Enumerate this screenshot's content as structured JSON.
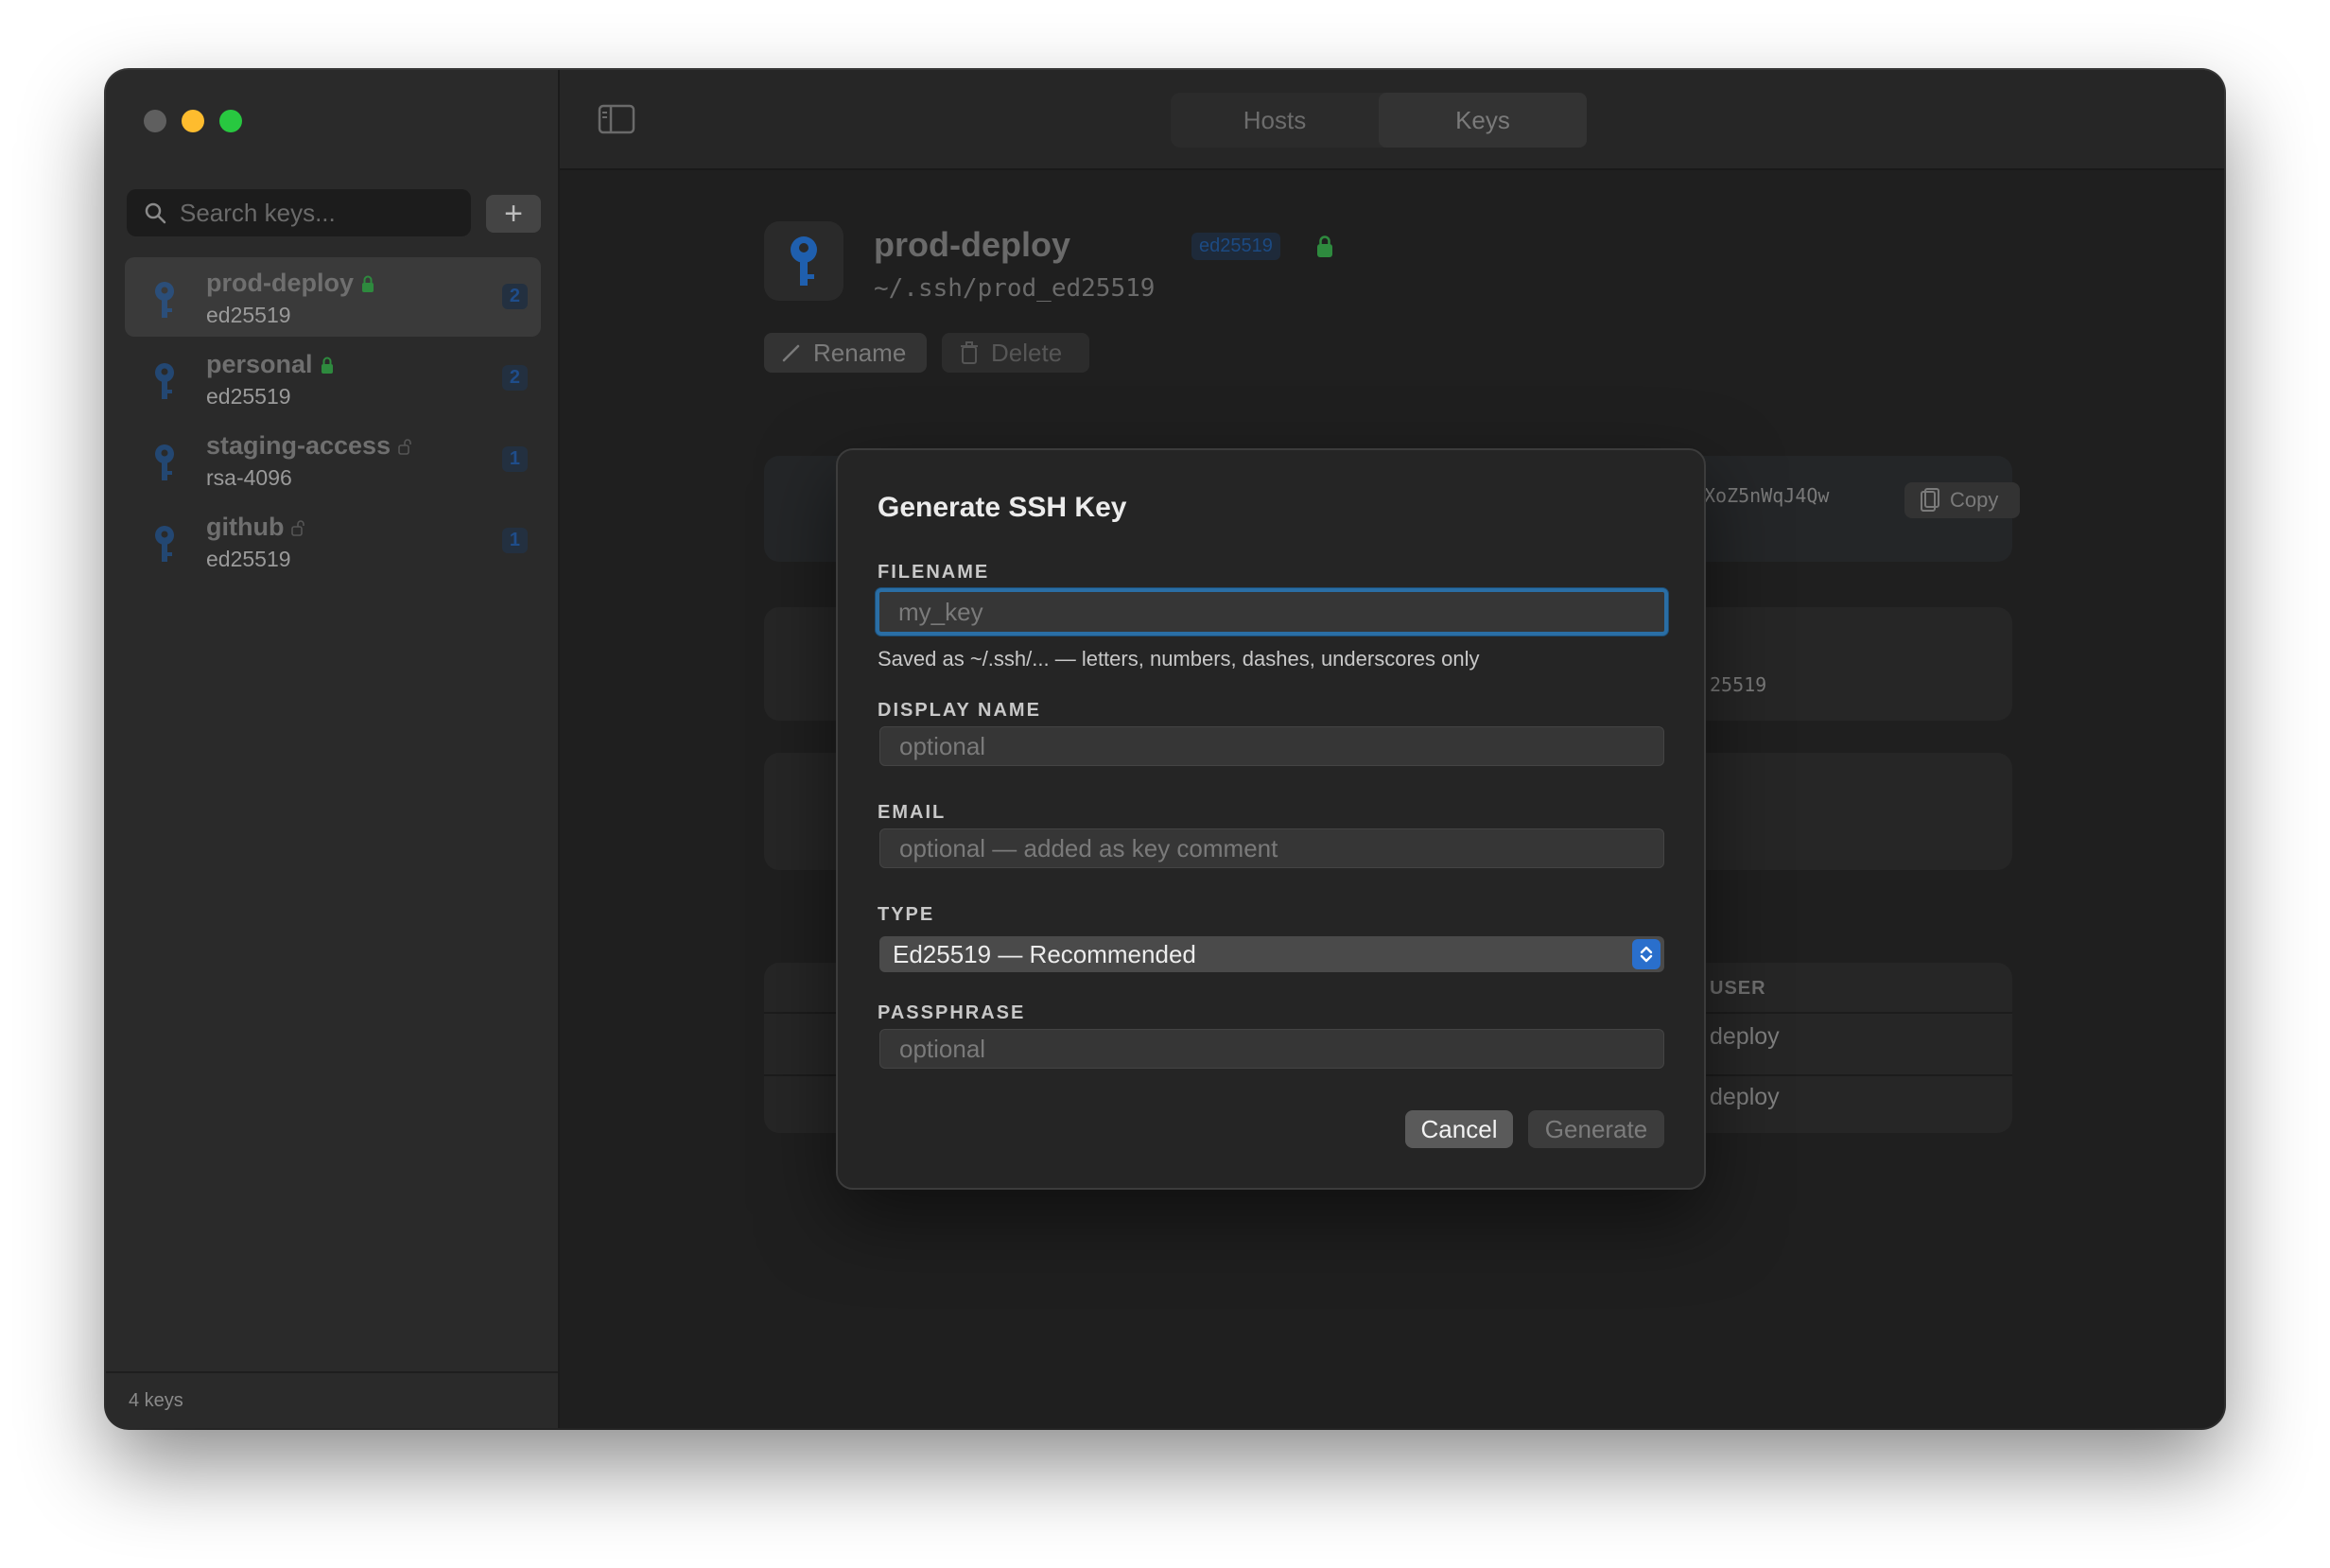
{
  "window": {
    "tabs": [
      {
        "label": "Hosts",
        "active": false
      },
      {
        "label": "Keys",
        "active": true
      }
    ]
  },
  "sidebar": {
    "search_placeholder": "Search keys...",
    "add_label": "+",
    "items": [
      {
        "name": "prod-deploy",
        "type": "ed25519",
        "count": "2",
        "locked": true,
        "selected": true
      },
      {
        "name": "personal",
        "type": "ed25519",
        "count": "2",
        "locked": true,
        "selected": false
      },
      {
        "name": "staging-access",
        "type": "rsa-4096",
        "count": "1",
        "locked": false,
        "selected": false
      },
      {
        "name": "github",
        "type": "ed25519",
        "count": "1",
        "locked": false,
        "selected": false
      }
    ],
    "footer": "4 keys"
  },
  "detail": {
    "title": "prod-deploy",
    "badge": "ed25519",
    "path": "~/.ssh/prod_ed25519",
    "rename_label": "Rename",
    "delete_label": "Delete",
    "public_key_snippet": "XoZ5nWqJ4Qw",
    "copy_label": "Copy",
    "type_snippet": "25519",
    "hosts_user_header": "USER",
    "host_rows": [
      {
        "user": "deploy"
      },
      {
        "user": "deploy"
      }
    ]
  },
  "dialog": {
    "title": "Generate SSH Key",
    "filename_label": "FILENAME",
    "filename_placeholder": "my_key",
    "filename_hint": "Saved as ~/.ssh/... — letters, numbers, dashes, underscores only",
    "display_name_label": "DISPLAY NAME",
    "display_name_placeholder": "optional",
    "email_label": "EMAIL",
    "email_placeholder": "optional — added as key comment",
    "type_label": "TYPE",
    "type_value": "Ed25519 — Recommended",
    "passphrase_label": "PASSPHRASE",
    "passphrase_placeholder": "optional",
    "cancel_label": "Cancel",
    "generate_label": "Generate"
  },
  "colors": {
    "accent": "#2a6fcc",
    "focus_ring": "#2a6ea5",
    "lock_green": "#2e8a3e",
    "key_blue": "#1f5fae"
  }
}
